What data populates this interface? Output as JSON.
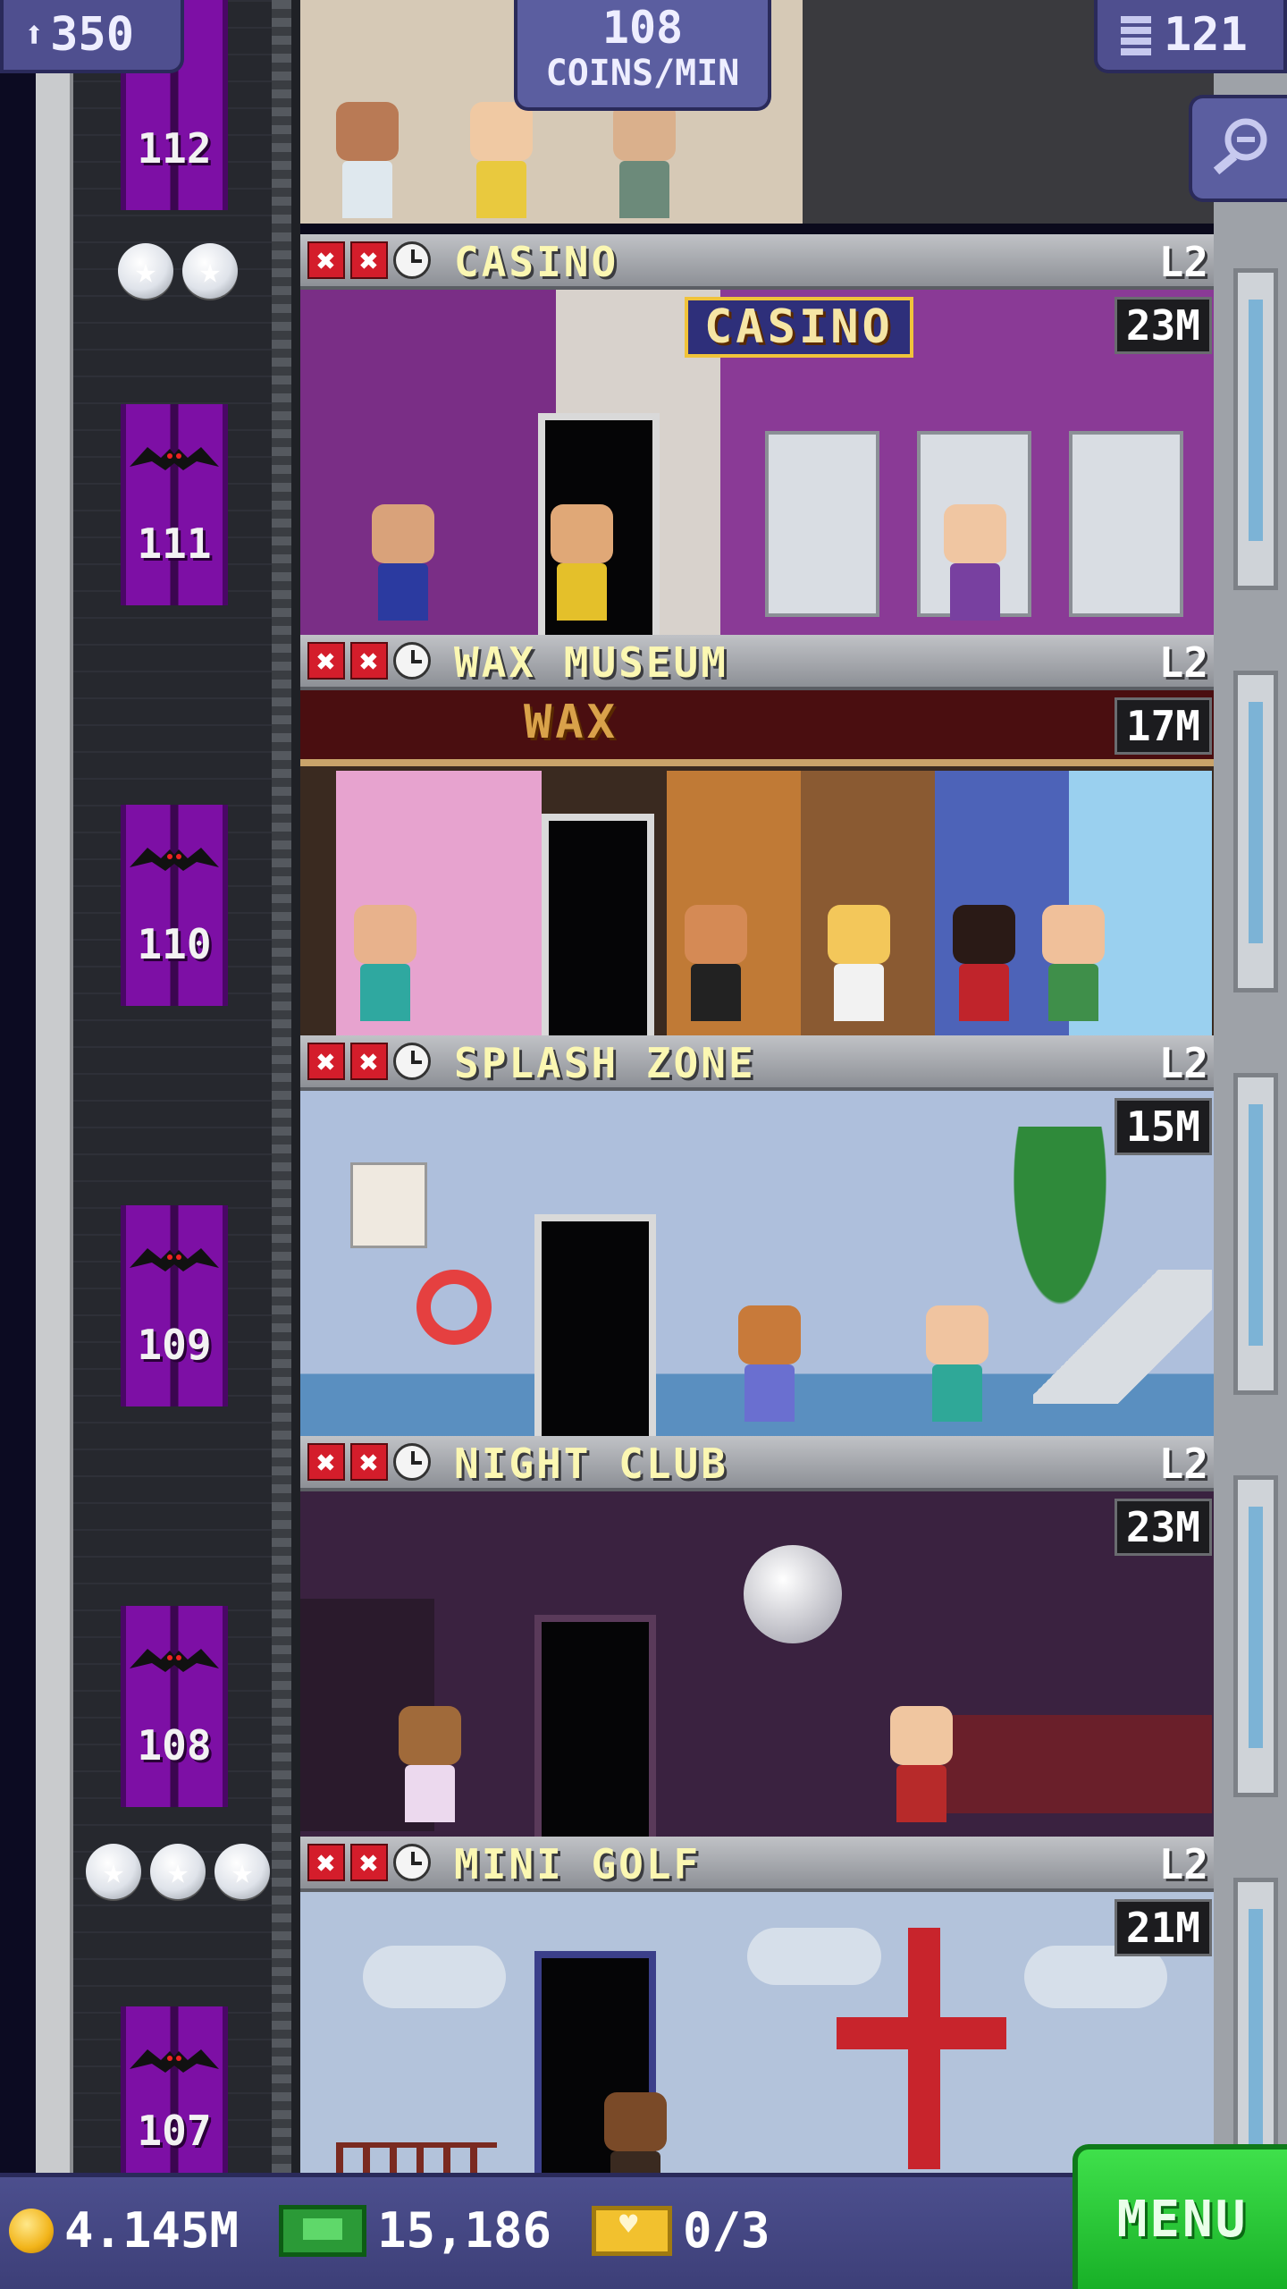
{
  "hud": {
    "population": "350",
    "coins_rate_value": "108",
    "coins_rate_unit": "COINS/MIN",
    "floor_count": "121"
  },
  "shaft": {
    "doors": [
      {
        "number": "112"
      },
      {
        "number": "111"
      },
      {
        "number": "110"
      },
      {
        "number": "109"
      },
      {
        "number": "108"
      },
      {
        "number": "107"
      }
    ],
    "star_marker_1": "★★",
    "star_marker_2": "★★★"
  },
  "floors": [
    {
      "name": "CASINO",
      "level": "L2",
      "price": "23M",
      "sign": "CASINO"
    },
    {
      "name": "WAX MUSEUM",
      "level": "L2",
      "price": "17M",
      "sign": "WAX"
    },
    {
      "name": "SPLASH ZONE",
      "level": "L2",
      "price": "15M",
      "sign": ""
    },
    {
      "name": "NIGHT CLUB",
      "level": "L2",
      "price": "23M",
      "sign": ""
    },
    {
      "name": "MINI GOLF",
      "level": "L2",
      "price": "21M",
      "sign": ""
    }
  ],
  "status_icons": {
    "x": "✖",
    "clock": "clock-icon"
  },
  "bottom_bar": {
    "coins": "4.145M",
    "bux": "15,186",
    "tickets": "0/3",
    "menu_label": "MENU"
  },
  "colors": {
    "elevator_purple": "#7d0fa5",
    "floor_title_yellow": "#fbf7b2",
    "menu_green": "#26c534",
    "hud_blue": "#4f4f8f"
  }
}
